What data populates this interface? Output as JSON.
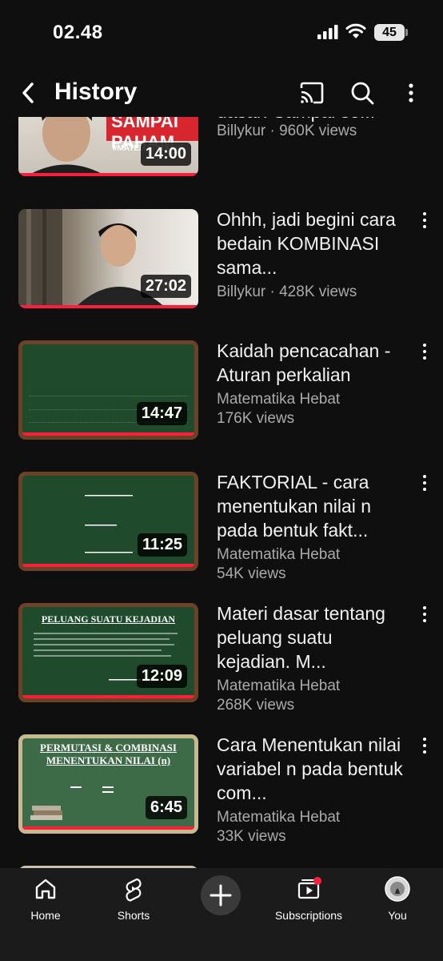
{
  "status": {
    "time": "02.48",
    "battery": "45"
  },
  "header": {
    "title": "History"
  },
  "videos": [
    {
      "title": "materi PELUANG dasar! Sampai se...",
      "channel": "Billykur",
      "views": "960K views",
      "meta_line": "Billykur · 960K views",
      "duration": "14:00",
      "thumb_text": "SAMPAI PAHAM",
      "thumb_tag": "#MATEMATIKASIK"
    },
    {
      "title": "Ohhh, jadi begini cara bedain KOMBINASI sama...",
      "meta_line": "Billykur · 428K views",
      "duration": "27:02"
    },
    {
      "title": "Kaidah pencacahan - Aturan perkalian",
      "channel": "Matematika Hebat",
      "views": "176K views",
      "duration": "14:47"
    },
    {
      "title": "FAKTORIAL - cara menentukan nilai n pada bentuk fakt...",
      "channel": "Matematika Hebat",
      "views": "54K views",
      "duration": "11:25"
    },
    {
      "title": "Materi dasar tentang peluang suatu kejadian. M...",
      "channel": "Matematika Hebat",
      "views": "268K views",
      "duration": "12:09",
      "thumb_heading": "PELUANG SUATU KEJADIAN"
    },
    {
      "title": "Cara Menentukan nilai variabel n pada bentuk com...",
      "channel": "Matematika Hebat",
      "views": "33K views",
      "duration": "6:45",
      "thumb_heading": "PERMUTASI & COMBINASI MENENTUKAN NILAI (n)"
    }
  ],
  "nav": {
    "home": "Home",
    "shorts": "Shorts",
    "subscriptions": "Subscriptions",
    "you": "You"
  },
  "colors": {
    "background": "#0f0f0f",
    "progress": "#ff1e3c",
    "meta_text": "#aaaaaa"
  }
}
